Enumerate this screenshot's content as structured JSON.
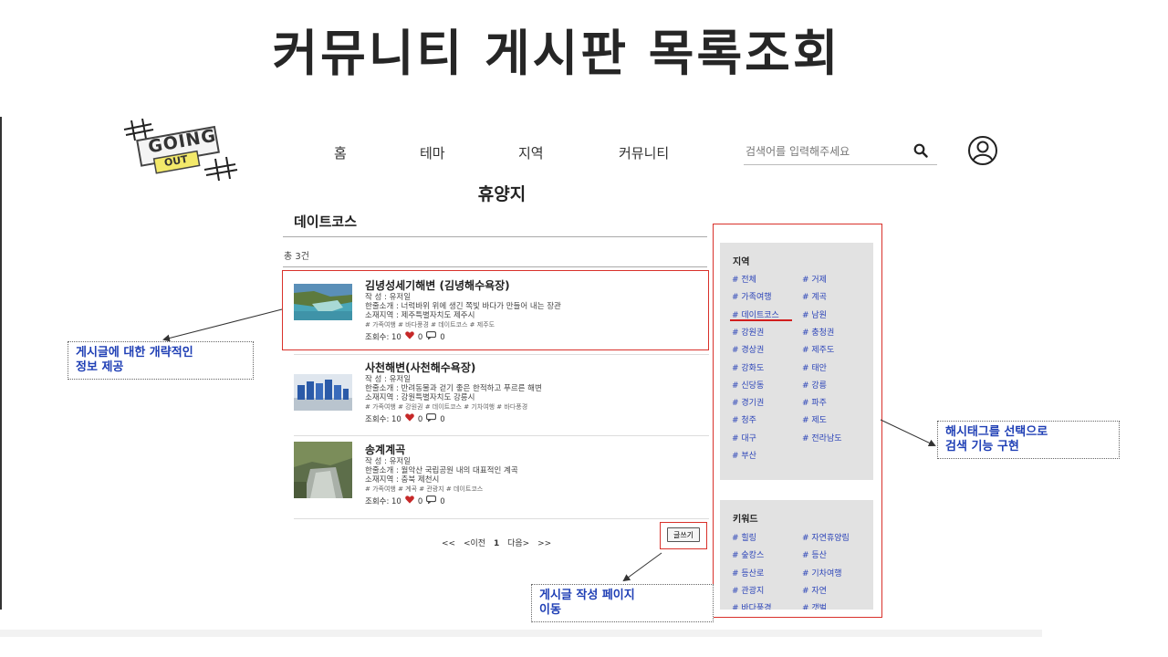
{
  "slide": {
    "title": "커뮤니티 게시판 목록조회"
  },
  "logo": {
    "line1": "GOING",
    "line2": "OUT"
  },
  "nav": {
    "items": [
      "홈",
      "테마",
      "지역",
      "커뮤니티"
    ]
  },
  "search": {
    "placeholder": "검색어를 입력해주세요"
  },
  "icons": {
    "search": "search-icon",
    "user": "user-circle-icon",
    "heart": "heart-icon",
    "comment": "comment-icon"
  },
  "page": {
    "heading": "휴양지",
    "category": "데이트코스",
    "total": "총 3건"
  },
  "posts": [
    {
      "title": "김녕성세기해변 (김녕해수욕장)",
      "author": "작 성 : 유저일",
      "summary": "한줄소개 : 너럭바위 위에 생긴 쪽빛 바다가 만들어 내는 장관",
      "location": "소재지역 : 제주특별자치도 제주시",
      "tags": "# 가족여행  # 바다풍경  # 데이트코스  # 제주도",
      "views": "조회수: 10",
      "likes": "0",
      "comments": "0"
    },
    {
      "title": "사천해변(사천해수욕장)",
      "author": "작 성 : 유저일",
      "summary": "한줄소개 : 반려동물과 걷기 좋은 한적하고 푸르른 해변",
      "location": "소재지역 : 강원특별자치도 강릉시",
      "tags": "# 가족여행  # 강원권  # 데이트코스  # 기차여행  # 바다풍경",
      "views": "조회수: 10",
      "likes": "0",
      "comments": "0"
    },
    {
      "title": "송계계곡",
      "author": "작 성 : 유저일",
      "summary": "한줄소개 : 월악산 국립공원 내의 대표적인 계곡",
      "location": "소재지역 : 충북 제천시",
      "tags": "# 가족여행  # 계곡  # 관광지  # 데이트코스",
      "views": "조회수: 10",
      "likes": "0",
      "comments": "0"
    }
  ],
  "pagination": {
    "first": "<<",
    "prev": "<이전",
    "current": "1",
    "next": "다음>",
    "last": ">>"
  },
  "write_button": "글쓰기",
  "sidebar": {
    "region_title": "지역",
    "region_tags": [
      "# 전체",
      "# 거제",
      "# 가족여행",
      "# 계곡",
      "# 데이트코스",
      "# 남원",
      "# 강원권",
      "# 충청권",
      "# 경상권",
      "# 제주도",
      "# 강화도",
      "# 태안",
      "# 신당동",
      "# 강릉",
      "# 경기권",
      "# 파주",
      "# 청주",
      "# 제도",
      "# 대구",
      "# 전라남도",
      "# 부산"
    ],
    "keyword_title": "키워드",
    "keyword_tags": [
      "# 힐링",
      "# 자연휴양림",
      "# 숲캉스",
      "# 등산",
      "# 등산로",
      "# 기차여행",
      "# 관광지",
      "# 자연",
      "# 바다풍경",
      "# 갯벌"
    ]
  },
  "annotations": {
    "post_summary": [
      "게시글에 대한 개략적인",
      "정보 제공"
    ],
    "hashtag_search": [
      "해시태그를 선택으로",
      "검색 기능 구현"
    ],
    "write_page": [
      "게시글 작성 페이지",
      "이동"
    ]
  },
  "colors": {
    "accent_red": "#d9312b",
    "tag_blue": "#2a43b8",
    "callout_blue": "#1f3fb5",
    "sidebar_bg": "#e2e2e2"
  }
}
